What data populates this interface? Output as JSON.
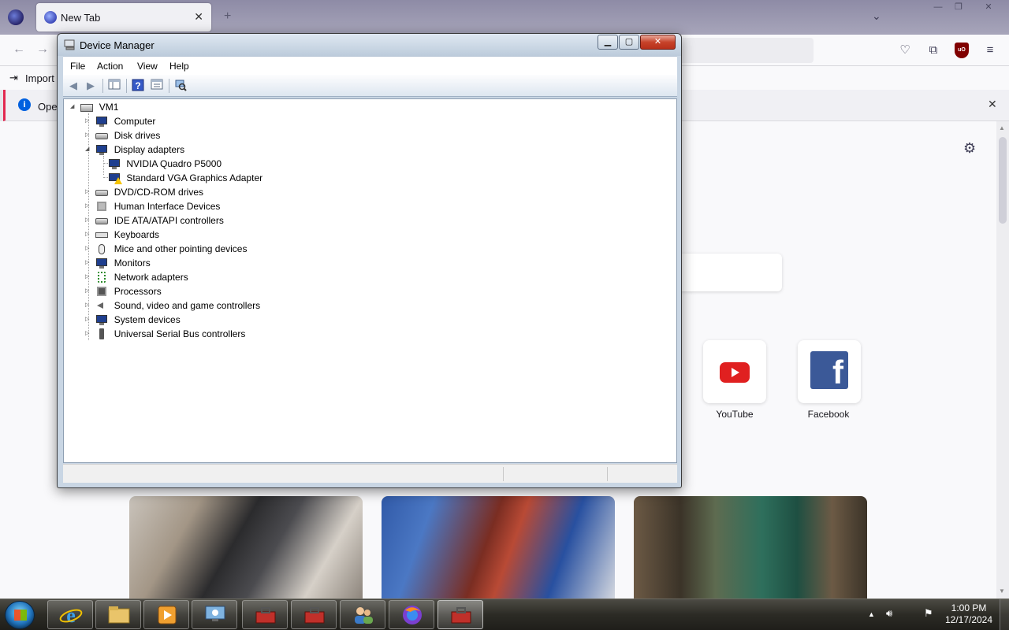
{
  "browser": {
    "tab_title": "New Tab",
    "tab_close": "✕",
    "new_tab": "+",
    "tab_list": "⌄",
    "import_label": "Import",
    "notice_text": "Open",
    "shortcuts": [
      {
        "label": "YouTube"
      },
      {
        "label": "Facebook"
      }
    ]
  },
  "device_manager": {
    "title": "Device Manager",
    "menu": [
      "File",
      "Action",
      "View",
      "Help"
    ],
    "tree": {
      "root": "VM1",
      "categories": [
        {
          "label": "Computer",
          "expanded": false,
          "icon": "computer-icon"
        },
        {
          "label": "Disk drives",
          "expanded": false,
          "icon": "disk-drive-icon"
        },
        {
          "label": "Display adapters",
          "expanded": true,
          "icon": "display-adapter-icon",
          "children": [
            {
              "label": "NVIDIA Quadro P5000",
              "icon": "display-adapter-icon",
              "warning": false
            },
            {
              "label": "Standard VGA Graphics Adapter",
              "icon": "display-adapter-icon",
              "warning": true
            }
          ]
        },
        {
          "label": "DVD/CD-ROM drives",
          "expanded": false,
          "icon": "dvd-drive-icon"
        },
        {
          "label": "Human Interface Devices",
          "expanded": false,
          "icon": "hid-icon"
        },
        {
          "label": "IDE ATA/ATAPI controllers",
          "expanded": false,
          "icon": "ide-controller-icon"
        },
        {
          "label": "Keyboards",
          "expanded": false,
          "icon": "keyboard-icon"
        },
        {
          "label": "Mice and other pointing devices",
          "expanded": false,
          "icon": "mouse-icon"
        },
        {
          "label": "Monitors",
          "expanded": false,
          "icon": "monitor-icon"
        },
        {
          "label": "Network adapters",
          "expanded": false,
          "icon": "network-adapter-icon"
        },
        {
          "label": "Processors",
          "expanded": false,
          "icon": "processor-icon"
        },
        {
          "label": "Sound, video and game controllers",
          "expanded": false,
          "icon": "speaker-icon"
        },
        {
          "label": "System devices",
          "expanded": false,
          "icon": "system-devices-icon"
        },
        {
          "label": "Universal Serial Bus controllers",
          "expanded": false,
          "icon": "usb-icon"
        }
      ]
    }
  },
  "taskbar": {
    "time": "1:00 PM",
    "date": "12/17/2024",
    "apps": [
      "internet-explorer-icon",
      "file-explorer-icon",
      "media-player-icon",
      "remote-desktop-icon",
      "toolbox-icon",
      "toolbox-icon",
      "users-icon",
      "firefox-icon",
      "device-manager-icon"
    ]
  },
  "colors": {
    "accent_warning": "#f5c400",
    "close_button": "#c7432a",
    "window_frame": "#c9d6e4"
  }
}
